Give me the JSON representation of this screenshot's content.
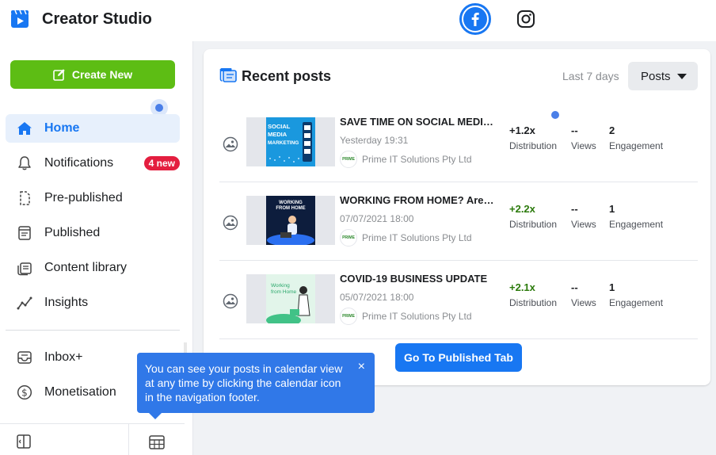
{
  "header": {
    "app_title": "Creator Studio",
    "platforms": [
      {
        "name": "facebook",
        "icon": "facebook-icon",
        "active": true
      },
      {
        "name": "instagram",
        "icon": "instagram-icon",
        "active": false
      }
    ]
  },
  "sidebar": {
    "create_label": "Create New",
    "items": [
      {
        "label": "Home",
        "icon": "home-icon",
        "active": true
      },
      {
        "label": "Notifications",
        "icon": "bell-icon",
        "badge": "4 new"
      },
      {
        "label": "Pre-published",
        "icon": "draft-icon"
      },
      {
        "label": "Published",
        "icon": "published-icon"
      },
      {
        "label": "Content library",
        "icon": "library-icon"
      },
      {
        "label": "Insights",
        "icon": "insights-icon"
      },
      {
        "label": "Inbox+",
        "icon": "inbox-icon"
      },
      {
        "label": "Monetisation",
        "icon": "dollar-icon"
      }
    ]
  },
  "card": {
    "title": "Recent posts",
    "range_label": "Last 7 days",
    "filter_value": "Posts",
    "posts": [
      {
        "title": "SAVE TIME ON SOCIAL MEDIA MARKETING",
        "date": "Yesterday 19:31",
        "page": "Prime IT Solutions Pty Ltd",
        "distribution": "+1.2x",
        "distribution_label": "Distribution",
        "views": "--",
        "views_label": "Views",
        "engagement": "2",
        "engagement_label": "Engagement",
        "thumb_text": "SOCIAL MEDIA MARKETING"
      },
      {
        "title": "WORKING FROM HOME? Are you ready?",
        "date": "07/07/2021 18:00",
        "page": "Prime IT Solutions Pty Ltd",
        "distribution": "+2.2x",
        "distribution_label": "Distribution",
        "views": "--",
        "views_label": "Views",
        "engagement": "1",
        "engagement_label": "Engagement",
        "thumb_text": "WORKING FROM HOME"
      },
      {
        "title": "COVID-19 BUSINESS UPDATE",
        "date": "05/07/2021 18:00",
        "page": "Prime IT Solutions Pty Ltd",
        "distribution": "+2.1x",
        "distribution_label": "Distribution",
        "views": "--",
        "views_label": "Views",
        "engagement": "1",
        "engagement_label": "Engagement",
        "thumb_text": "Working from Home"
      }
    ],
    "goto_label": "Go To Published Tab"
  },
  "tooltip": {
    "text": "You can see your posts in calendar view at any time by clicking the calendar icon in the navigation footer.",
    "close": "×"
  },
  "colors": {
    "accent": "#1877f2",
    "create": "#5dbd14",
    "badge": "#e41e3f",
    "positive": "#2b7a0b",
    "tooltip": "#3078e8"
  }
}
